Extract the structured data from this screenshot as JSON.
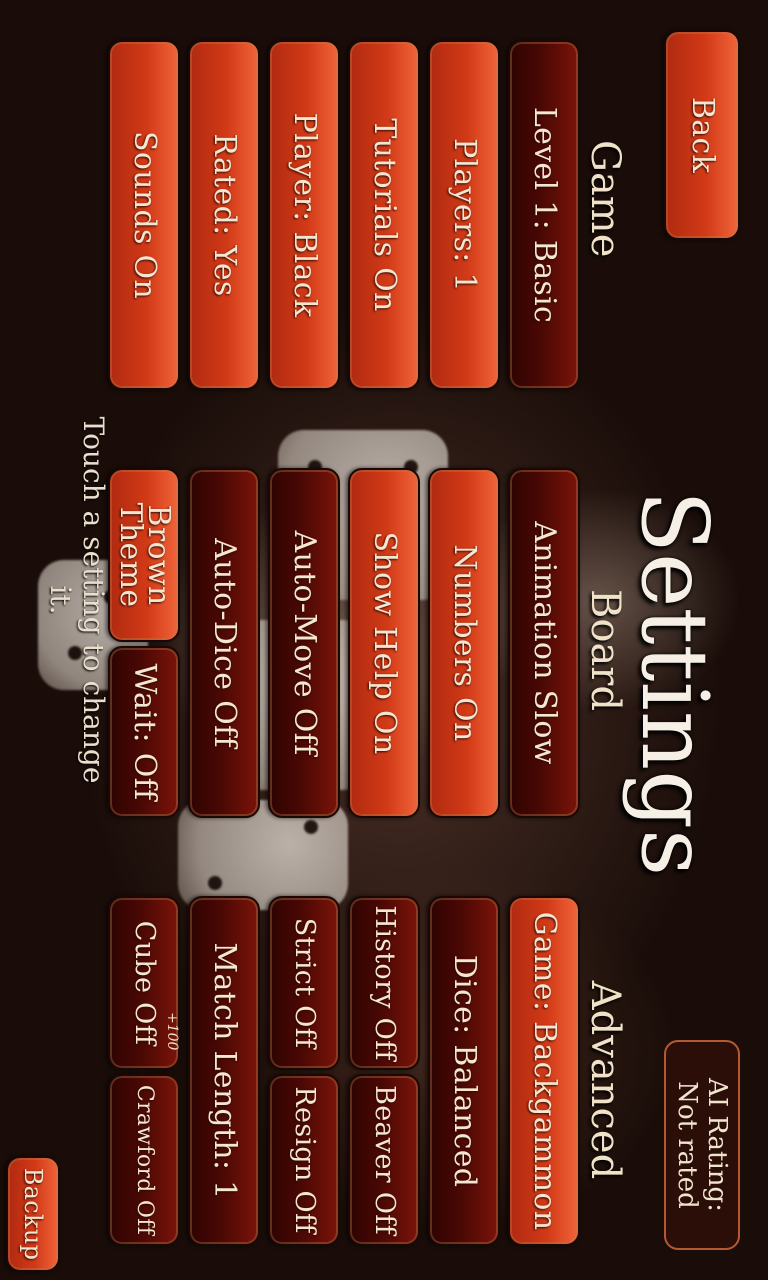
{
  "title": "Settings",
  "back_label": "Back",
  "ai_rating": {
    "line1": "AI Rating:",
    "line2": "Not rated"
  },
  "sections": {
    "game": "Game",
    "board": "Board",
    "advanced": "Advanced"
  },
  "game": {
    "level": "Level 1: Basic",
    "players": "Players: 1",
    "tutorials": "Tutorials On",
    "player": "Player: Black",
    "rated": "Rated: Yes",
    "sounds": "Sounds On"
  },
  "board": {
    "animation": "Animation Slow",
    "numbers": "Numbers On",
    "show_help": "Show Help On",
    "auto_move": "Auto-Move Off",
    "auto_dice": "Auto-Dice Off",
    "theme": "Brown Theme",
    "wait": "Wait: Off"
  },
  "advanced": {
    "game": "Game: Backgammon",
    "dice": "Dice: Balanced",
    "history": "History Off",
    "beaver": "Beaver Off",
    "strict": "Strict Off",
    "resign": "Resign Off",
    "match_length": "Match Length: 1",
    "cube": "Cube Off",
    "cube_superscript": "+100",
    "crawford": "Crawford Off"
  },
  "hint": "Touch a setting to change it.",
  "backup_label": "Backup",
  "colors": {
    "on": "#d23a17",
    "off": "#4a0804",
    "text": "#f4e6d0"
  }
}
